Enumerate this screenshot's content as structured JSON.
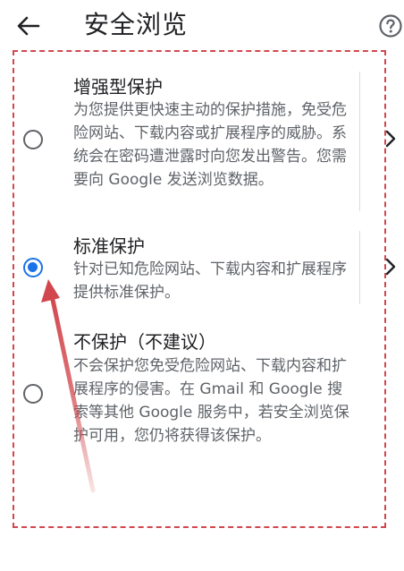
{
  "appbar": {
    "title": "安全浏览",
    "back_icon": "arrow-back-icon",
    "help_icon": "help-icon"
  },
  "options": [
    {
      "id": "enhanced",
      "title": "增强型保护",
      "description": "为您提供更快速主动的保护措施，免受危险网站、下载内容或扩展程序的威胁。系统会在密码遭泄露时向您发出警告。您需要向 Google 发送浏览数据。",
      "selected": false,
      "has_details": true
    },
    {
      "id": "standard",
      "title": "标准保护",
      "description": "针对已知危险网站、下载内容和扩展程序提供标准保护。",
      "selected": true,
      "has_details": true
    },
    {
      "id": "none",
      "title": "不保护（不建议）",
      "description": "不会保护您免受危险网站、下载内容和扩展程序的侵害。在 Gmail 和 Google 搜索等其他 Google 服务中，若安全浏览保护可用，您仍将获得该保护。",
      "selected": false,
      "has_details": false
    }
  ],
  "colors": {
    "accent": "#1a73e8",
    "annotation": "#d2474d",
    "text_primary": "#202124",
    "text_secondary": "#5f6368"
  }
}
